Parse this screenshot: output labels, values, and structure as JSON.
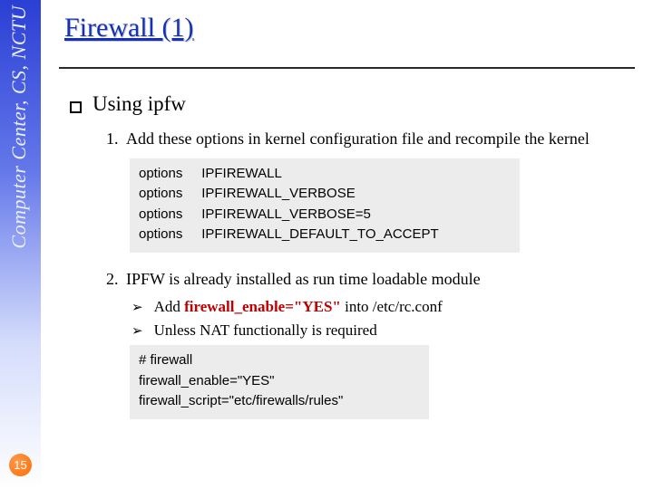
{
  "sidebar_text": "Computer Center, CS, NCTU",
  "slide_number": "15",
  "title": "Firewall (1)",
  "bullet_main": "Using ipfw",
  "item1": {
    "marker": "1.",
    "text": "Add these options in kernel configuration file and recompile the kernel"
  },
  "code1": {
    "l1": "options     IPFIREWALL",
    "l2": "options     IPFIREWALL_VERBOSE",
    "l3": "options     IPFIREWALL_VERBOSE=5",
    "l4": "options     IPFIREWALL_DEFAULT_TO_ACCEPT"
  },
  "item2": {
    "marker": "2.",
    "text": "IPFW is already installed as run time loadable module"
  },
  "sub2a_prefix": "Add ",
  "sub2a_highlight": "firewall_enable=\"YES\"",
  "sub2a_suffix": " into /etc/rc.conf",
  "sub2b": "Unless NAT functionally is required",
  "code2": {
    "l1": "# firewall",
    "l2": "firewall_enable=\"YES\"",
    "l3": "firewall_script=\"etc/firewalls/rules\""
  }
}
